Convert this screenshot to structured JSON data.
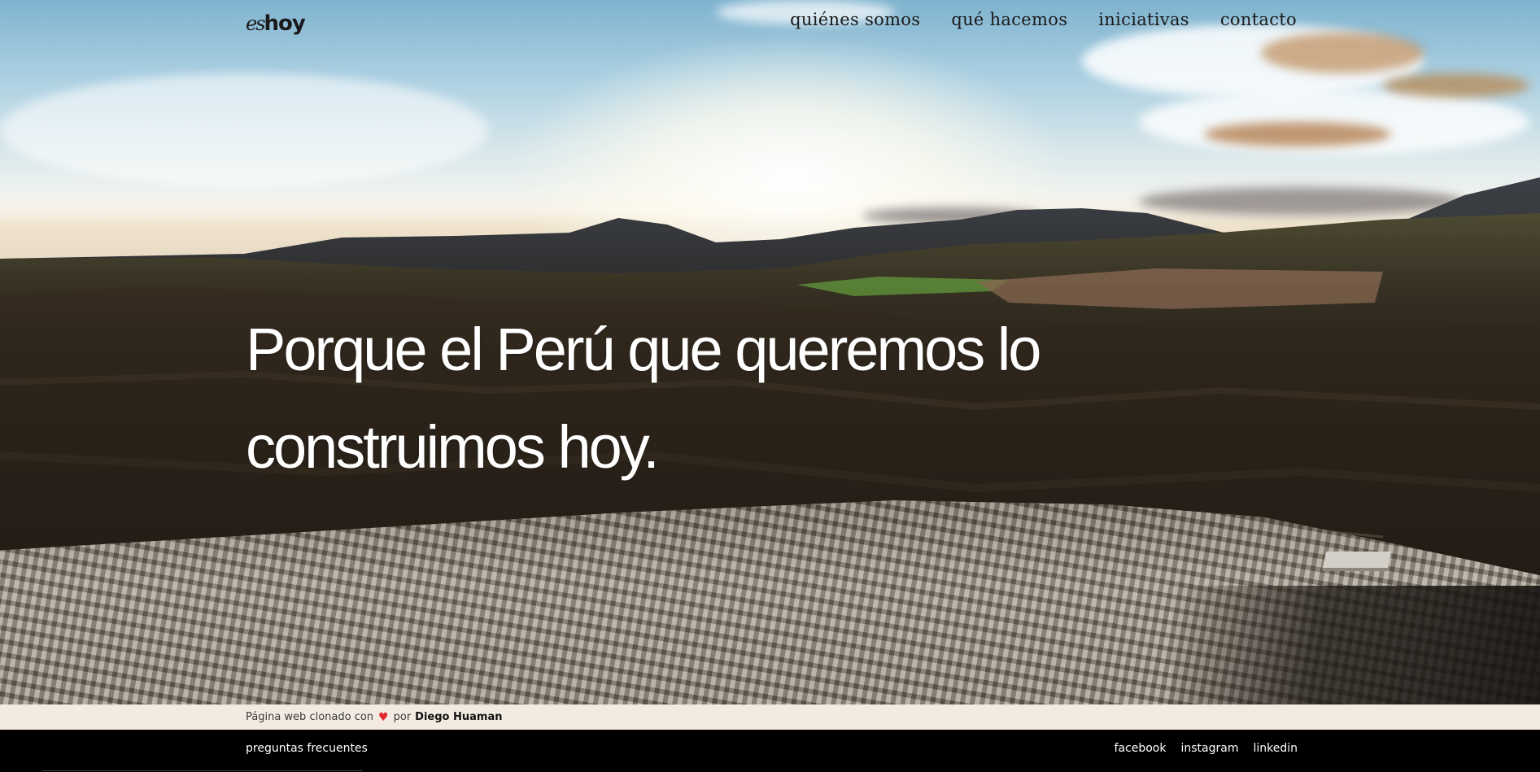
{
  "header": {
    "logo": {
      "script": "es",
      "bold": "hoy"
    },
    "nav": [
      {
        "label": "quiénes somos"
      },
      {
        "label": "qué hacemos"
      },
      {
        "label": "iniciativas"
      },
      {
        "label": "contacto"
      }
    ]
  },
  "hero": {
    "headline_line1": "Porque el Perú que queremos lo",
    "headline_line2": "construimos hoy."
  },
  "credit": {
    "prefix": "Página web clonado con",
    "heart_icon": "heart-icon",
    "by": "por",
    "author": "Diego Huaman",
    "heart_color": "#e0262f"
  },
  "footer": {
    "faq": "preguntas frecuentes",
    "social": [
      {
        "label": "facebook"
      },
      {
        "label": "instagram"
      },
      {
        "label": "linkedin"
      }
    ]
  },
  "colors": {
    "credit_bar_bg": "#f3ebe1",
    "footer_bg": "#000000",
    "headline_text": "#ffffff"
  }
}
